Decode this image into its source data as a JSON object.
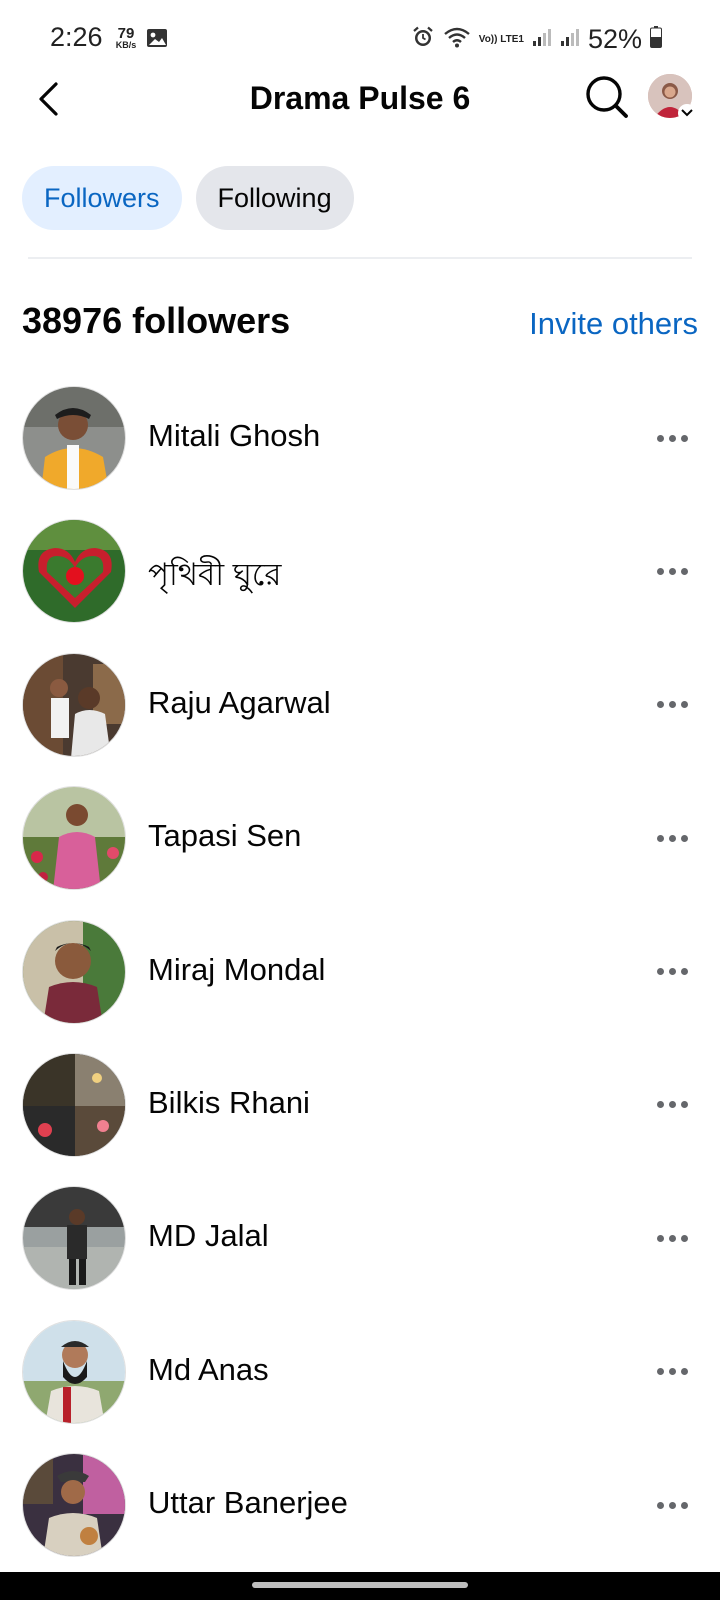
{
  "status_bar": {
    "time": "2:26",
    "speed_value": "79",
    "speed_unit": "KB/s",
    "network_label": "Vo)) LTE1",
    "battery": "52%"
  },
  "header": {
    "title": "Drama Pulse 6",
    "back_icon": "back-arrow-icon",
    "search_icon": "search-icon",
    "profile_icon": "profile-avatar"
  },
  "tabs": [
    {
      "label": "Followers",
      "active": true
    },
    {
      "label": "Following",
      "active": false
    }
  ],
  "section": {
    "count_label": "38976 followers",
    "invite_label": "Invite others"
  },
  "colors": {
    "accent": "#0a66c2",
    "active_tab_bg": "#e3efff",
    "inactive_tab_bg": "#e4e6eb",
    "text": "#050505",
    "icon_gray": "#65676b"
  },
  "followers": [
    {
      "name": "Mitali Ghosh"
    },
    {
      "name": "পৃথিবী ঘুরে"
    },
    {
      "name": "Raju Agarwal"
    },
    {
      "name": "Tapasi Sen"
    },
    {
      "name": "Miraj Mondal"
    },
    {
      "name": "Bilkis Rhani"
    },
    {
      "name": "MD Jalal"
    },
    {
      "name": "Md Anas"
    },
    {
      "name": "Uttar Banerjee"
    }
  ]
}
